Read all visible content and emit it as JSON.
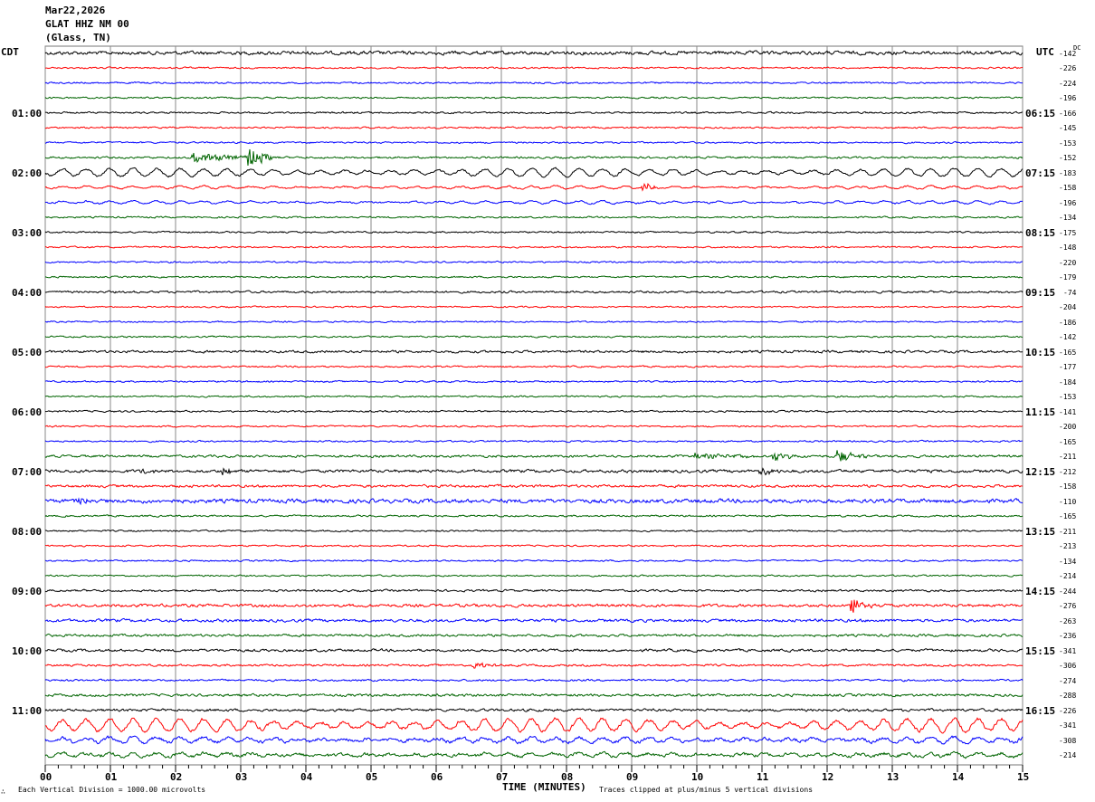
{
  "header": {
    "date": "Mar22,2026",
    "station": "GLAT HHZ NM 00",
    "location": "(Glass, TN)"
  },
  "left_zone": "CDT",
  "right_zone": "UTC",
  "dc_label": "DC",
  "footer": {
    "scale_note": "Each Vertical Division = 1000.00 microvolts",
    "clip_note": "Traces clipped at plus/minus 5 vertical divisions",
    "mark": "∴"
  },
  "chart_data": {
    "type": "line",
    "title": "GLAT HHZ NM 00 (Glass, TN) Mar22,2026",
    "xlabel": "TIME (MINUTES)",
    "xlim": [
      0,
      15
    ],
    "x_ticks": [
      "00",
      "01",
      "02",
      "03",
      "04",
      "05",
      "06",
      "07",
      "08",
      "09",
      "10",
      "11",
      "12",
      "13",
      "14",
      "15"
    ],
    "grid": true,
    "series_colors": [
      "#000000",
      "#ff0000",
      "#0000ff",
      "#006400"
    ],
    "left_hour_labels": [
      "01:00",
      "02:00",
      "03:00",
      "04:00",
      "05:00",
      "06:00",
      "07:00",
      "08:00",
      "09:00",
      "10:00",
      "11:00"
    ],
    "right_hour_labels": [
      "06:15",
      "07:15",
      "08:15",
      "09:15",
      "10:15",
      "11:15",
      "12:15",
      "13:15",
      "14:15",
      "15:15",
      "16:15"
    ],
    "dc_offsets": [
      -142,
      -226,
      -224,
      -196,
      -166,
      -145,
      -153,
      -152,
      -183,
      -158,
      -196,
      -134,
      -175,
      -148,
      -220,
      -179,
      -74,
      -204,
      -186,
      -142,
      -165,
      -177,
      -184,
      -153,
      -141,
      -200,
      -165,
      -211,
      -212,
      -158,
      -110,
      -165,
      -211,
      -213,
      -134,
      -214,
      -244,
      -276,
      -263,
      -236,
      -341,
      -306,
      -274,
      -288,
      -226,
      -341,
      -308,
      -214
    ],
    "noise_level": [
      2.2,
      1,
      1,
      1,
      1.1,
      1,
      1,
      1.2,
      1.2,
      1,
      1,
      1,
      1,
      1,
      1,
      1,
      1.3,
      0.9,
      0.9,
      1,
      1.5,
      1,
      1,
      1,
      1.1,
      1,
      1,
      1.5,
      1.8,
      1.6,
      2.4,
      1.1,
      1,
      1,
      1,
      1,
      1.3,
      1.8,
      1.8,
      1.5,
      1.6,
      1.3,
      1.2,
      1.6,
      1.6,
      2,
      2,
      2
    ],
    "microseism": [
      {
        "trace": 8,
        "amplitude": 4.5,
        "period_min": 0.36
      },
      {
        "trace": 9,
        "amplitude": 1.5,
        "period_min": 0.36
      },
      {
        "trace": 10,
        "amplitude": 1.5,
        "period_min": 0.36
      },
      {
        "trace": 45,
        "amplitude": 7,
        "period_min": 0.36
      },
      {
        "trace": 46,
        "amplitude": 3,
        "period_min": 0.36
      },
      {
        "trace": 47,
        "amplitude": 2,
        "period_min": 0.36
      }
    ],
    "events": [
      {
        "trace": 7,
        "minute": 2.3,
        "duration": 1.2,
        "amplitude": 5
      },
      {
        "trace": 7,
        "minute": 3.15,
        "duration": 0.4,
        "amplitude": 11
      },
      {
        "trace": 9,
        "minute": 9.2,
        "duration": 0.3,
        "amplitude": 4
      },
      {
        "trace": 27,
        "minute": 11.2,
        "duration": 0.5,
        "amplitude": 5
      },
      {
        "trace": 27,
        "minute": 12.2,
        "duration": 0.4,
        "amplitude": 7
      },
      {
        "trace": 27,
        "minute": 10.0,
        "duration": 1.0,
        "amplitude": 3
      },
      {
        "trace": 28,
        "minute": 1.5,
        "duration": 0.2,
        "amplitude": 4
      },
      {
        "trace": 28,
        "minute": 2.75,
        "duration": 0.2,
        "amplitude": 5
      },
      {
        "trace": 28,
        "minute": 11.0,
        "duration": 0.4,
        "amplitude": 4
      },
      {
        "trace": 30,
        "minute": 0.5,
        "duration": 0.4,
        "amplitude": 4
      },
      {
        "trace": 37,
        "minute": 12.4,
        "duration": 0.5,
        "amplitude": 9
      },
      {
        "trace": 41,
        "minute": 6.6,
        "duration": 0.4,
        "amplitude": 3
      }
    ]
  }
}
